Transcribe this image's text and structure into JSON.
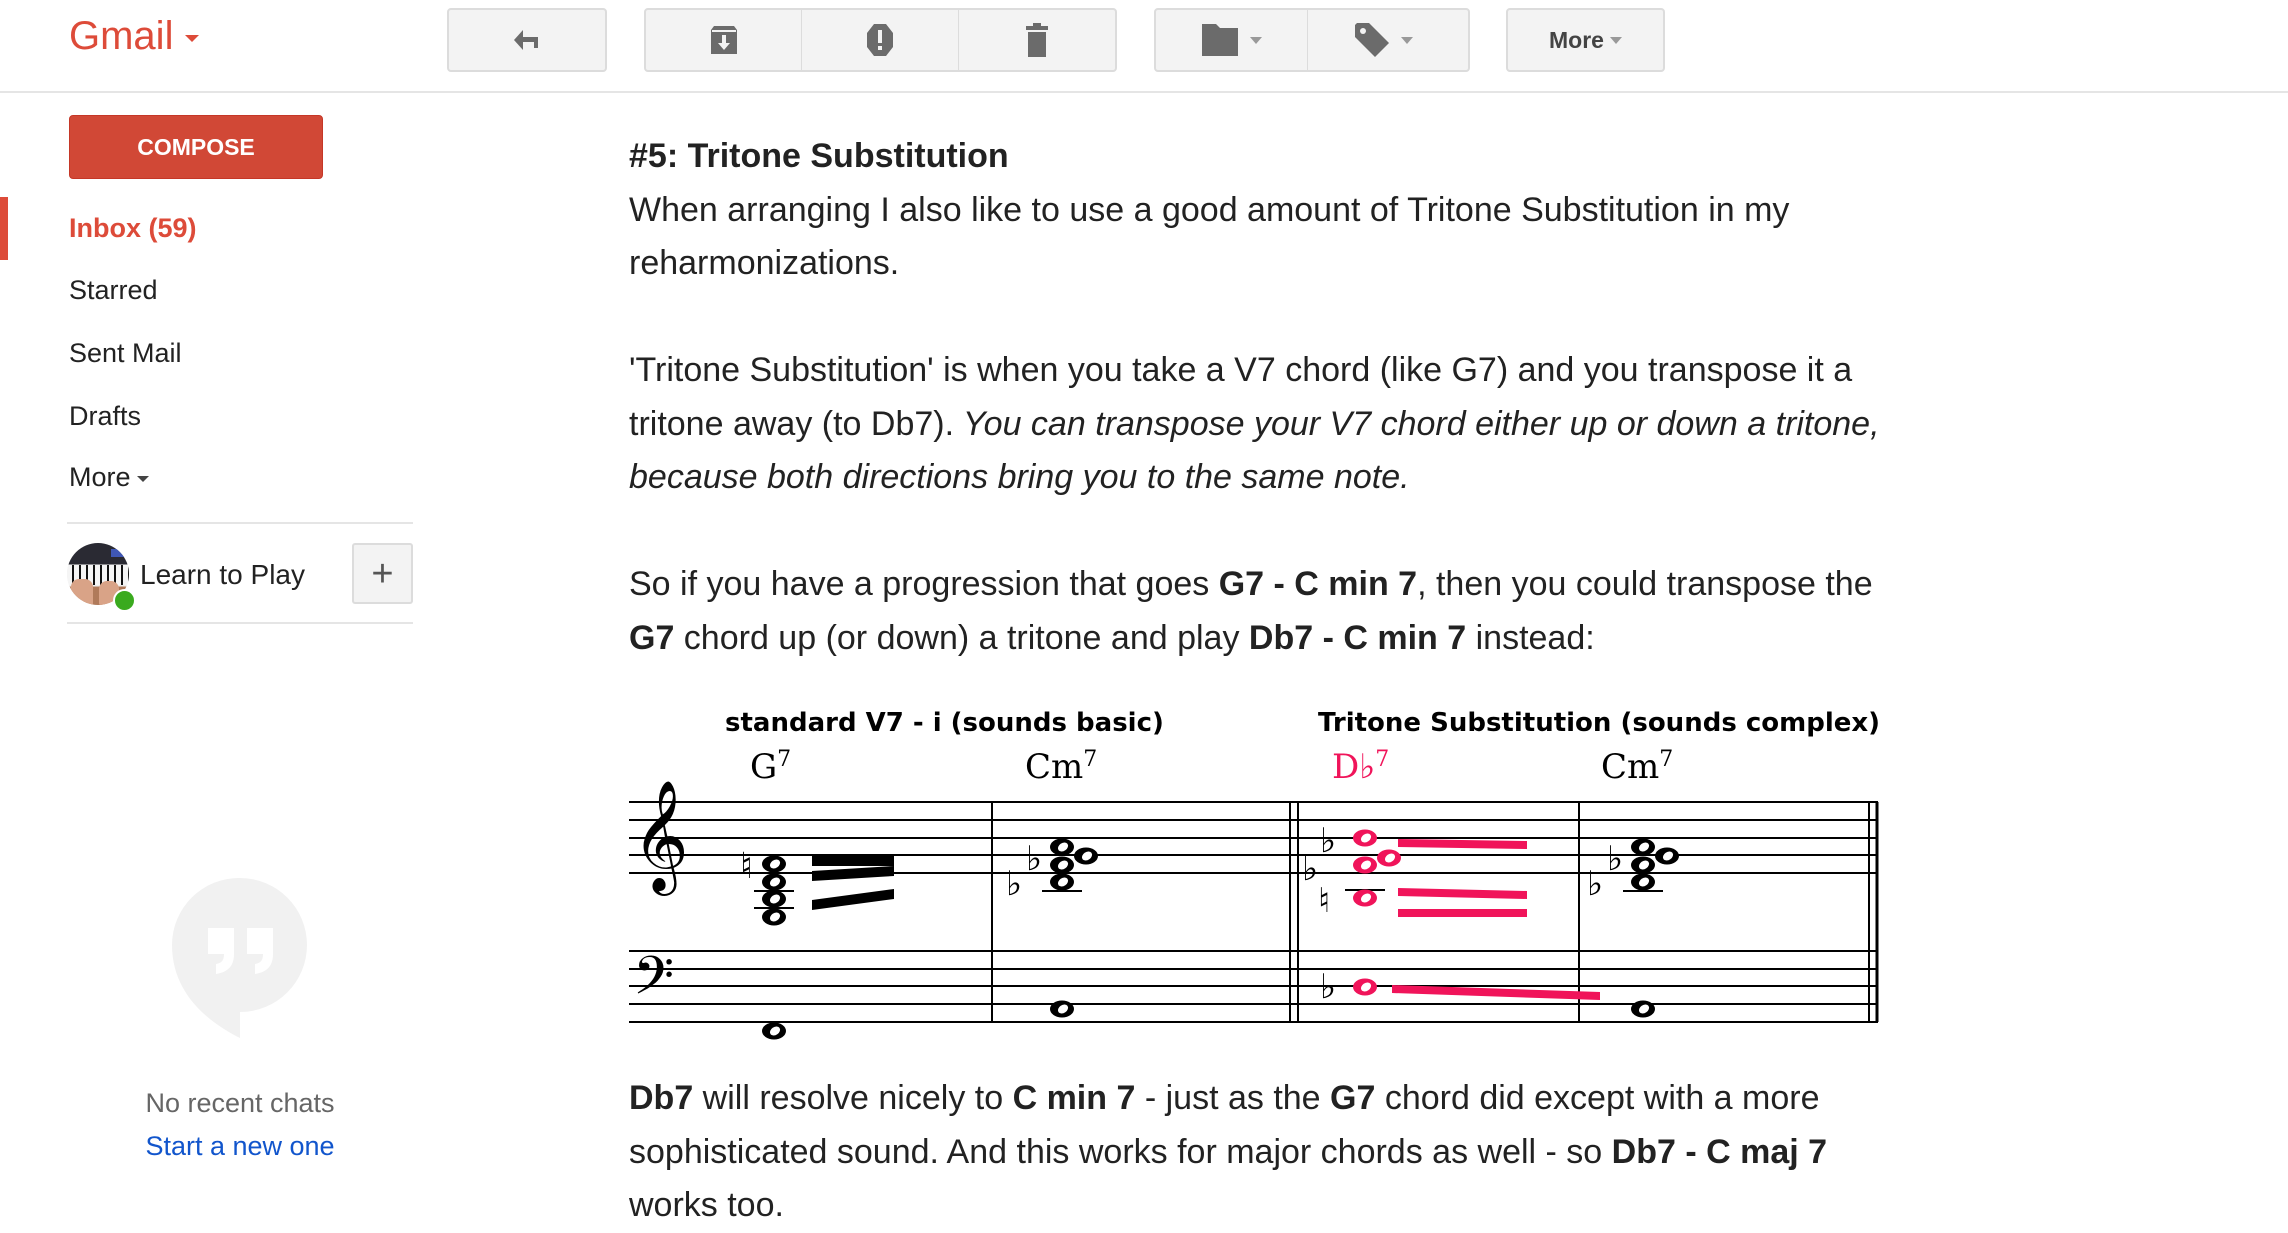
{
  "header": {
    "app_name": "Gmail",
    "toolbar": {
      "reply": "reply-icon",
      "archive": "archive-icon",
      "report_spam": "report-spam-icon",
      "delete": "delete-icon",
      "move_to": "folder-icon",
      "labels": "label-icon",
      "more_label": "More"
    }
  },
  "sidebar": {
    "compose_label": "COMPOSE",
    "items": [
      {
        "label": "Inbox (59)",
        "active": true
      },
      {
        "label": "Starred"
      },
      {
        "label": "Sent Mail"
      },
      {
        "label": "Drafts"
      },
      {
        "label": "More"
      }
    ],
    "contact": {
      "name": "Learn to Play",
      "status": "online"
    },
    "add_label": "+",
    "hangouts": {
      "empty_text": "No recent chats",
      "start_link": "Start a new one"
    }
  },
  "message": {
    "heading": "#5: Tritone Substitution",
    "p1": "When arranging I also like to use a good amount of Tritone Substitution in my reharmonizations.",
    "p2_plain": "'Tritone Substitution' is when you take a V7 chord (like G7) and you transpose it a tritone away (to Db7).",
    "p2_italic": " You can transpose your V7 chord either up or down a tritone, because both directions bring you to the same note.",
    "p3": [
      {
        "t": "So if you have a progression that goes ",
        "b": false
      },
      {
        "t": "G7 - C min 7",
        "b": true
      },
      {
        "t": ", then you could transpose the ",
        "b": false
      },
      {
        "t": "G7",
        "b": true
      },
      {
        "t": " chord up (or down) a tritone and play ",
        "b": false
      },
      {
        "t": "Db7 - C min 7",
        "b": true
      },
      {
        "t": " instead:",
        "b": false
      }
    ],
    "p4": [
      {
        "t": "Db7",
        "b": true
      },
      {
        "t": " will resolve nicely to ",
        "b": false
      },
      {
        "t": "C min 7",
        "b": true
      },
      {
        "t": " - just as the ",
        "b": false
      },
      {
        "t": "G7",
        "b": true
      },
      {
        "t": " chord did except with a more sophisticated sound. And this works for major chords as well - so ",
        "b": false
      },
      {
        "t": "Db7 - C maj 7",
        "b": true
      },
      {
        "t": " works too.",
        "b": false
      }
    ]
  },
  "notation": {
    "left_title": "standard V7 - i (sounds basic)",
    "right_title": "Tritone Substitution (sounds complex)",
    "chords": [
      {
        "root": "G",
        "ext": "7",
        "highlight": false
      },
      {
        "root": "Cm",
        "ext": "7",
        "highlight": false
      },
      {
        "root": "D♭",
        "ext": "7",
        "highlight": true
      },
      {
        "root": "Cm",
        "ext": "7",
        "highlight": false
      }
    ],
    "highlight_color": "#f0145a"
  }
}
